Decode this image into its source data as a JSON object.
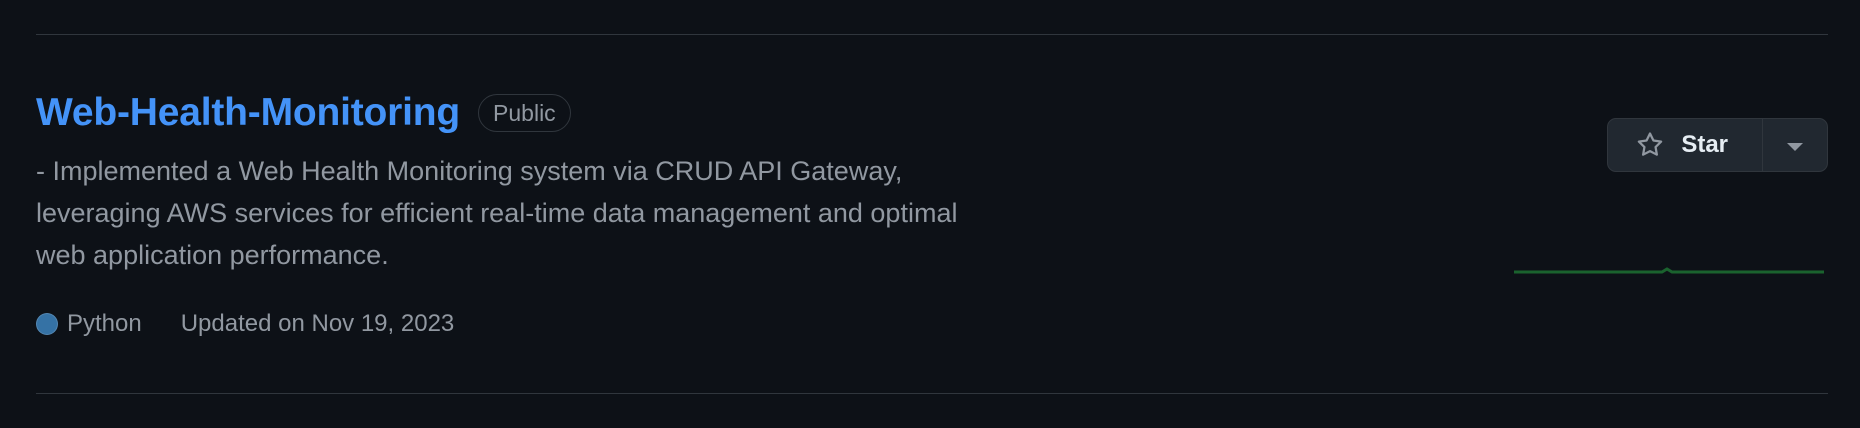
{
  "repo": {
    "name": "Web-Health-Monitoring",
    "visibility": "Public",
    "description": "- Implemented a Web Health Monitoring system via CRUD API Gateway, leveraging AWS services for efficient real-time data management and optimal web application performance.",
    "language": "Python",
    "language_color": "#3572A5",
    "updated": "Updated on Nov 19, 2023"
  },
  "actions": {
    "star_label": "Star",
    "star_icon": "star-icon",
    "menu_icon": "triangle-down-icon"
  },
  "activity": {
    "graph_color": "#26a641"
  },
  "colors": {
    "background": "#0d1117",
    "link": "#4493f8",
    "muted": "#9198a1",
    "border": "#30363d"
  }
}
